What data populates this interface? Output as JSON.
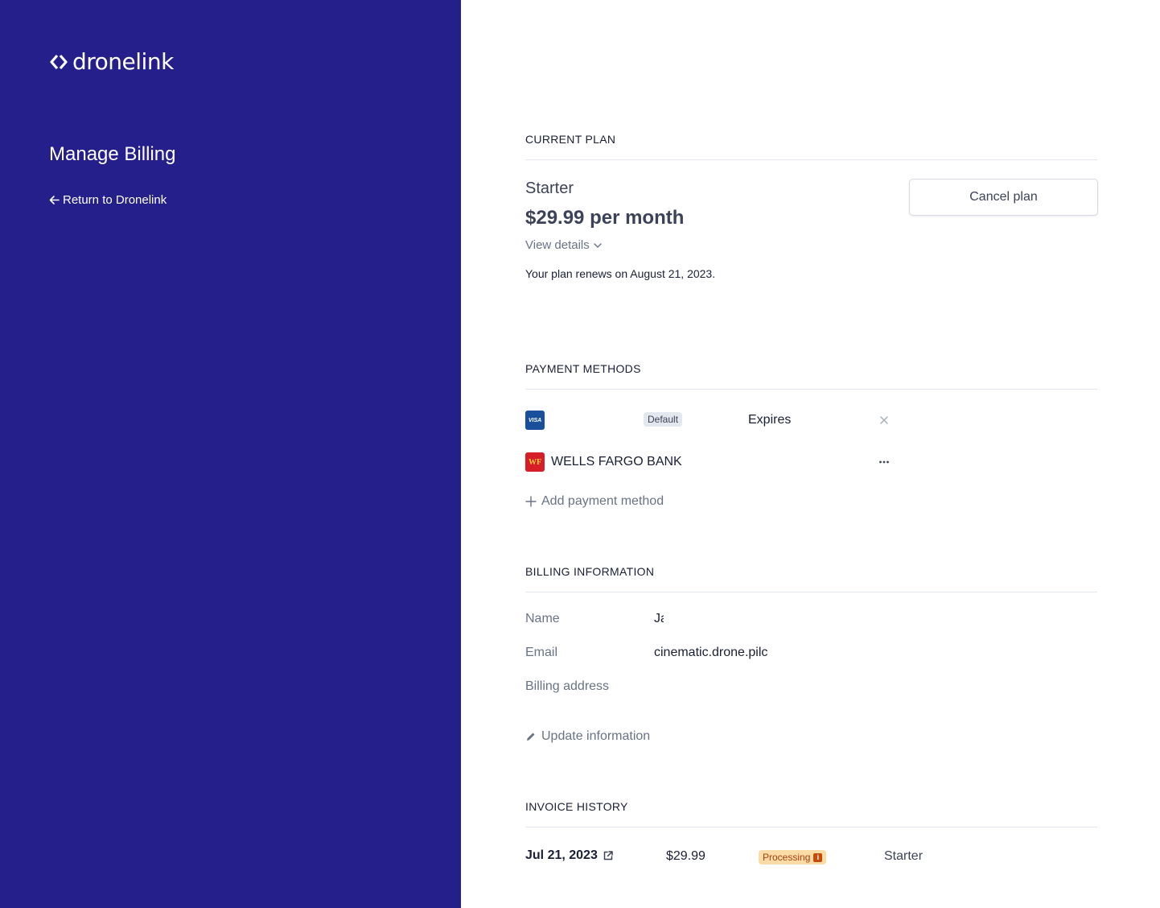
{
  "sidebar": {
    "brand": "dronelink",
    "title": "Manage Billing",
    "return_link": "Return to Dronelink"
  },
  "current_plan": {
    "heading": "CURRENT PLAN",
    "plan_name": "Starter",
    "price": "$29.99 per month",
    "view_details": "View details",
    "renewal": "Your plan renews on August 21, 2023.",
    "cancel_button": "Cancel plan"
  },
  "payment_methods": {
    "heading": "PAYMENT METHODS",
    "card": {
      "icon": "visa-icon",
      "icon_text": "VISA",
      "badge": "Default",
      "expires": "Expires"
    },
    "bank": {
      "icon": "wells-fargo-icon",
      "icon_text": "WF",
      "name": "WELLS FARGO BANK"
    },
    "add_label": "Add payment method"
  },
  "billing_info": {
    "heading": "BILLING INFORMATION",
    "name_label": "Name",
    "name_value": "Ja",
    "email_label": "Email",
    "email_value": "cinematic.drone.pilc",
    "address_label": "Billing address",
    "update_label": "Update information"
  },
  "invoice_history": {
    "heading": "INVOICE HISTORY",
    "rows": [
      {
        "date": "Jul 21, 2023",
        "amount": "$29.99",
        "status": "Processing",
        "plan": "Starter"
      }
    ]
  },
  "colors": {
    "sidebar_bg": "#251f8b",
    "status_processing_bg": "#fcdca6",
    "status_processing_text": "#a4400c"
  }
}
